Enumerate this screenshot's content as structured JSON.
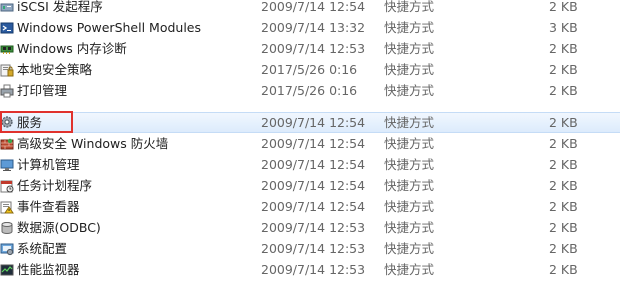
{
  "file_list": {
    "rows": [
      {
        "name": "iSCSI 发起程序",
        "date": "2009/7/14 12:54",
        "type": "快捷方式",
        "size": "2 KB",
        "icon": "iscsi-icon"
      },
      {
        "name": "Windows PowerShell Modules",
        "date": "2009/7/14 13:32",
        "type": "快捷方式",
        "size": "3 KB",
        "icon": "powershell-icon"
      },
      {
        "name": "Windows 内存诊断",
        "date": "2009/7/14 12:53",
        "type": "快捷方式",
        "size": "2 KB",
        "icon": "memory-diagnostic-icon"
      },
      {
        "name": "本地安全策略",
        "date": "2017/5/26 0:16",
        "type": "快捷方式",
        "size": "2 KB",
        "icon": "security-policy-icon"
      },
      {
        "name": "打印管理",
        "date": "2017/5/26 0:16",
        "type": "快捷方式",
        "size": "2 KB",
        "icon": "printer-icon"
      },
      {
        "name": "服务",
        "date": "2009/7/14 12:54",
        "type": "快捷方式",
        "size": "2 KB",
        "icon": "services-gear-icon"
      },
      {
        "name": "高级安全 Windows 防火墙",
        "date": "2009/7/14 12:54",
        "type": "快捷方式",
        "size": "2 KB",
        "icon": "firewall-icon"
      },
      {
        "name": "计算机管理",
        "date": "2009/7/14 12:54",
        "type": "快捷方式",
        "size": "2 KB",
        "icon": "computer-management-icon"
      },
      {
        "name": "任务计划程序",
        "date": "2009/7/14 12:54",
        "type": "快捷方式",
        "size": "2 KB",
        "icon": "task-scheduler-icon"
      },
      {
        "name": "事件查看器",
        "date": "2009/7/14 12:54",
        "type": "快捷方式",
        "size": "2 KB",
        "icon": "event-viewer-icon"
      },
      {
        "name": "数据源(ODBC)",
        "date": "2009/7/14 12:53",
        "type": "快捷方式",
        "size": "2 KB",
        "icon": "odbc-icon"
      },
      {
        "name": "系统配置",
        "date": "2009/7/14 12:53",
        "type": "快捷方式",
        "size": "2 KB",
        "icon": "system-config-icon"
      },
      {
        "name": "性能监视器",
        "date": "2009/7/14 12:53",
        "type": "快捷方式",
        "size": "2 KB",
        "icon": "performance-monitor-icon"
      }
    ],
    "selected_index": 5,
    "highlighted_index": 5
  },
  "colors": {
    "selection": "#dcebfc",
    "highlight_border": "#e0322d",
    "meta_text": "#666666"
  }
}
